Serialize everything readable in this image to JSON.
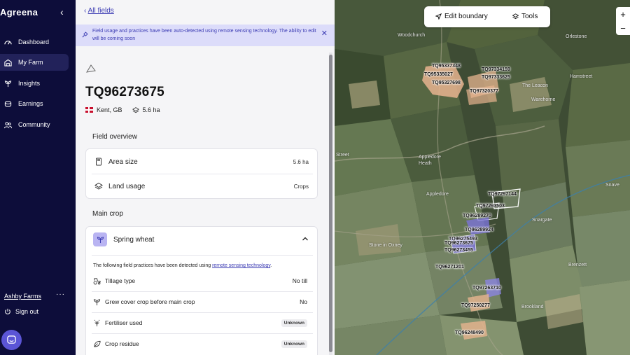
{
  "sidebar": {
    "logo": "Agreena",
    "collapse_icon": "chevron-left-icon",
    "items": [
      {
        "label": "Dashboard",
        "icon": "dashboard-icon",
        "active": false
      },
      {
        "label": "My Farm",
        "icon": "farm-icon",
        "active": true
      },
      {
        "label": "Insights",
        "icon": "sprout-icon",
        "active": false
      },
      {
        "label": "Earnings",
        "icon": "coins-icon",
        "active": false
      },
      {
        "label": "Community",
        "icon": "people-icon",
        "active": false
      }
    ],
    "farm_name": "Ashby Farms",
    "more_label": "···",
    "signout_label": "Sign out",
    "chat_icon": "chat-icon"
  },
  "panel": {
    "back_label": "All fields",
    "notice": "Field usage and practices have been auto-detected using remote sensing technology. The ability to edit will be coming soon",
    "field_id": "TQ96273675",
    "location": "Kent, GB",
    "area": "5.6 ha",
    "overview_title": "Field overview",
    "overview_rows": [
      {
        "label": "Area size",
        "value": "5.6 ha",
        "icon": "calculator-icon"
      },
      {
        "label": "Land usage",
        "value": "Crops",
        "icon": "layers-icon"
      }
    ],
    "main_crop_title": "Main crop",
    "crop_name": "Spring wheat",
    "detected_text": "The following field practices have been detected using ",
    "detected_link": "remote sensing technology",
    "detected_end": ".",
    "practices": [
      {
        "label": "Tillage type",
        "value": "No till",
        "badge": false,
        "icon": "tractor-icon"
      },
      {
        "label": "Grew cover crop before main crop",
        "value": "No",
        "badge": false,
        "icon": "sprout-icon"
      },
      {
        "label": "Fertiliser used",
        "value": "Unknown",
        "badge": true,
        "icon": "fertiliser-icon"
      },
      {
        "label": "Crop residue",
        "value": "Unknown",
        "badge": true,
        "icon": "leaf-icon"
      }
    ]
  },
  "map": {
    "toolbar": {
      "edit_label": "Edit boundary",
      "tools_label": "Tools"
    },
    "zoom_in": "+",
    "zoom_out": "−",
    "places": [
      "Woodchurch",
      "Orlestone",
      "Hamstreet",
      "The Leacon",
      "Warehorne",
      "Street",
      "Appledore Heath",
      "Appledore",
      "Snave",
      "Snargate",
      "Stone in Oxney",
      "Brenzett",
      "Brookland"
    ],
    "field_labels": [
      "TQ95337348",
      "TQ95335027",
      "TQ95327698",
      "TQ97334159",
      "TQ97333625",
      "TQ97320377",
      "TQ97297144",
      "TQ97293503",
      "TQ96289270",
      "TQ96289924",
      "TQ96275493",
      "TQ96273675",
      "TQ96273455",
      "TQ96271201",
      "TQ97263710",
      "TQ97250277",
      "TQ96248490"
    ]
  }
}
